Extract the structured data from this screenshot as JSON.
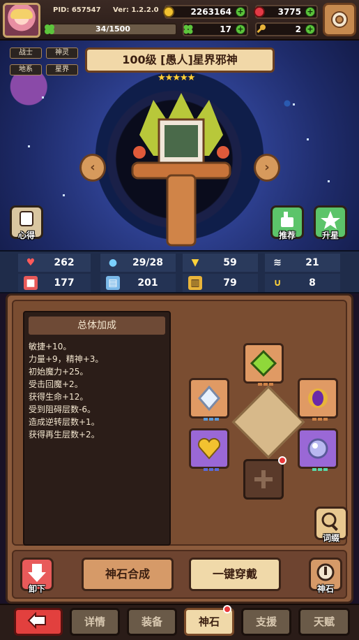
{
  "topbar": {
    "pid": "PID: 657547",
    "version": "Ver: 1.2.2.0",
    "gold": "2263164",
    "gems": "3775",
    "exp": "34/1500",
    "exp_progress": 0.0227,
    "clover": "17",
    "keys": "2"
  },
  "hero": {
    "tags": [
      "战士",
      "神灵",
      "地系",
      "星界"
    ],
    "name": "100级 [愚人]星界邪神",
    "star_count": 5,
    "insight_label": "心得",
    "recommend_label": "推荐",
    "upgrade_label": "升星"
  },
  "stats": {
    "hp": "262",
    "mana": "29/28",
    "shield": "59",
    "speed": "21",
    "attack": "177",
    "magic": "201",
    "defense": "79",
    "luck": "8"
  },
  "bonus": {
    "title": "总体加成",
    "lines": [
      "敏捷+10。",
      "力量+9，精神+3。",
      "初始魔力+25。",
      "受击回魔+2。",
      "获得生命+12。",
      "受到阻碍层数-6。",
      "造成逆转层数+1。",
      "获得再生层数+2。"
    ]
  },
  "actions": {
    "unequip": "卸下",
    "synthesize": "神石合成",
    "equip_all": "一键穿戴",
    "godstone": "神石",
    "affix": "词缀"
  },
  "nav": {
    "tabs": [
      "详情",
      "装备",
      "神石",
      "支援",
      "天赋"
    ],
    "active": "神石"
  },
  "colors": {
    "accent_red": "#e2403e",
    "panel_brown": "#8c5b3c",
    "gem_purple": "#9a68d6",
    "gem_orange": "#e09a64"
  }
}
